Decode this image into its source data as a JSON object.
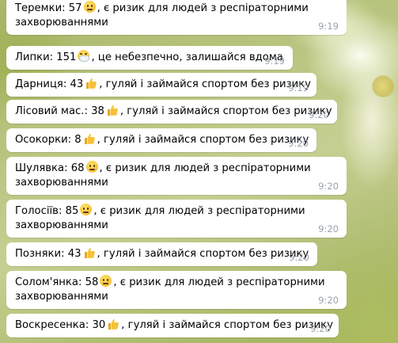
{
  "messages": [
    {
      "name": "Теремки",
      "text_before": "Теремки: 57",
      "emoji": "neutral-face-icon",
      "text_after": ", є ризик для людей з респіраторними захворюваннями",
      "time": "9:19"
    },
    {
      "name": "Липки",
      "text_before": "Липки: 151",
      "emoji": "mask-face-icon",
      "text_after": ", це небезпечно, залишайся вдома",
      "time": "9:19"
    },
    {
      "name": "Дарниця",
      "text_before": "Дарниця: 43",
      "emoji": "thumbs-up-icon",
      "text_after": ", гуляй і займайся спортом без ризику",
      "time": "9:19"
    },
    {
      "name": "Лісовий мас.",
      "text_before": "Лісовий мас.: 38",
      "emoji": "thumbs-up-icon",
      "text_after": ", гуляй і займайся спортом без ризику",
      "time": "9:20"
    },
    {
      "name": "Осокорки",
      "text_before": "Осокорки: 8",
      "emoji": "thumbs-up-icon",
      "text_after": ", гуляй і займайся спортом без ризику",
      "time": "9:20"
    },
    {
      "name": "Шулявка",
      "text_before": "Шулявка: 68",
      "emoji": "neutral-face-icon",
      "text_after": ", є ризик для людей з респіраторними захворюваннями",
      "time": "9:20"
    },
    {
      "name": "Голосіїв",
      "text_before": "Голосіїв: 85",
      "emoji": "neutral-face-icon",
      "text_after": ", є ризик для людей з респіраторними захворюваннями",
      "time": "9:20"
    },
    {
      "name": "Позняки",
      "text_before": "Позняки: 43",
      "emoji": "thumbs-up-icon",
      "text_after": ", гуляй і займайся спортом без ризику",
      "time": "9:20"
    },
    {
      "name": "Солом'янка",
      "text_before": "Солом'янка: 58",
      "emoji": "neutral-face-icon",
      "text_after": ", є ризик для людей з респіраторними захворюваннями",
      "time": "9:20"
    },
    {
      "name": "Воскресенка",
      "text_before": "Воскресенка: 30",
      "emoji": "thumbs-up-icon",
      "text_after": ", гуляй і займайся спортом без ризику",
      "time": "9:20"
    }
  ],
  "colors": {
    "bubble": "#ffffff",
    "time": "#97a4ad",
    "text": "#000000"
  }
}
